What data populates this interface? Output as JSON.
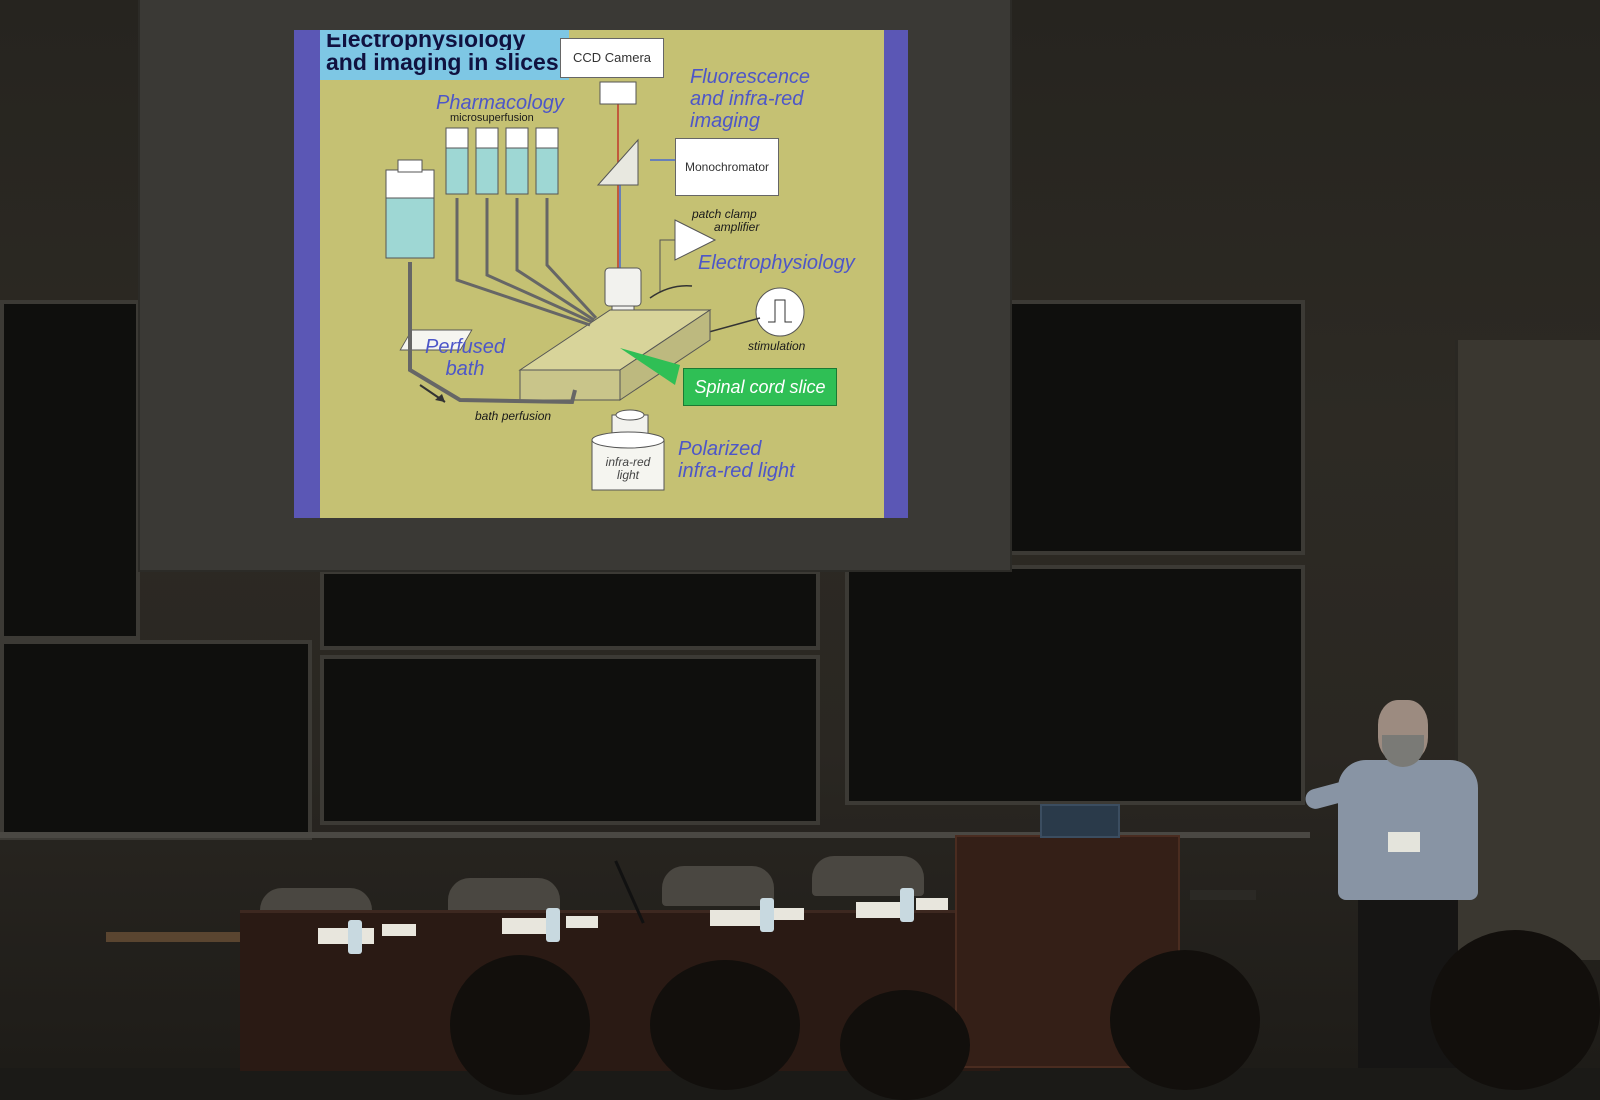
{
  "slide": {
    "title_line1": "Electrophysiology",
    "title_line2": "and imaging in slices",
    "labels": {
      "ccd_camera": "CCD Camera",
      "fluorescence": "Fluorescence",
      "and_infra_red": "and infra-red",
      "imaging": "imaging",
      "pharmacology": "Pharmacology",
      "microsuperfusion": "microsuperfusion",
      "monochromator": "Monochromator",
      "patch_clamp": "patch clamp",
      "amplifier": "amplifier",
      "electrophysiology": "Electrophysiology",
      "stimulation": "stimulation",
      "perfused": "Perfused",
      "bath": "bath",
      "spinal_cord_slice": "Spinal cord slice",
      "bath_perfusion": "bath perfusion",
      "polarized": "Polarized",
      "infra_red_light": "infra-red light",
      "infra_red": "infra-red",
      "light": "light"
    },
    "colors": {
      "background": "#c5c173",
      "border": "#5b57b5",
      "title_band": "#7ec7e4",
      "label_blue": "#4d56c8",
      "spinal_green": "#2fbf55"
    }
  },
  "icons": [
    "lightning-bolt-arrow-icon",
    "pulse-icon"
  ]
}
